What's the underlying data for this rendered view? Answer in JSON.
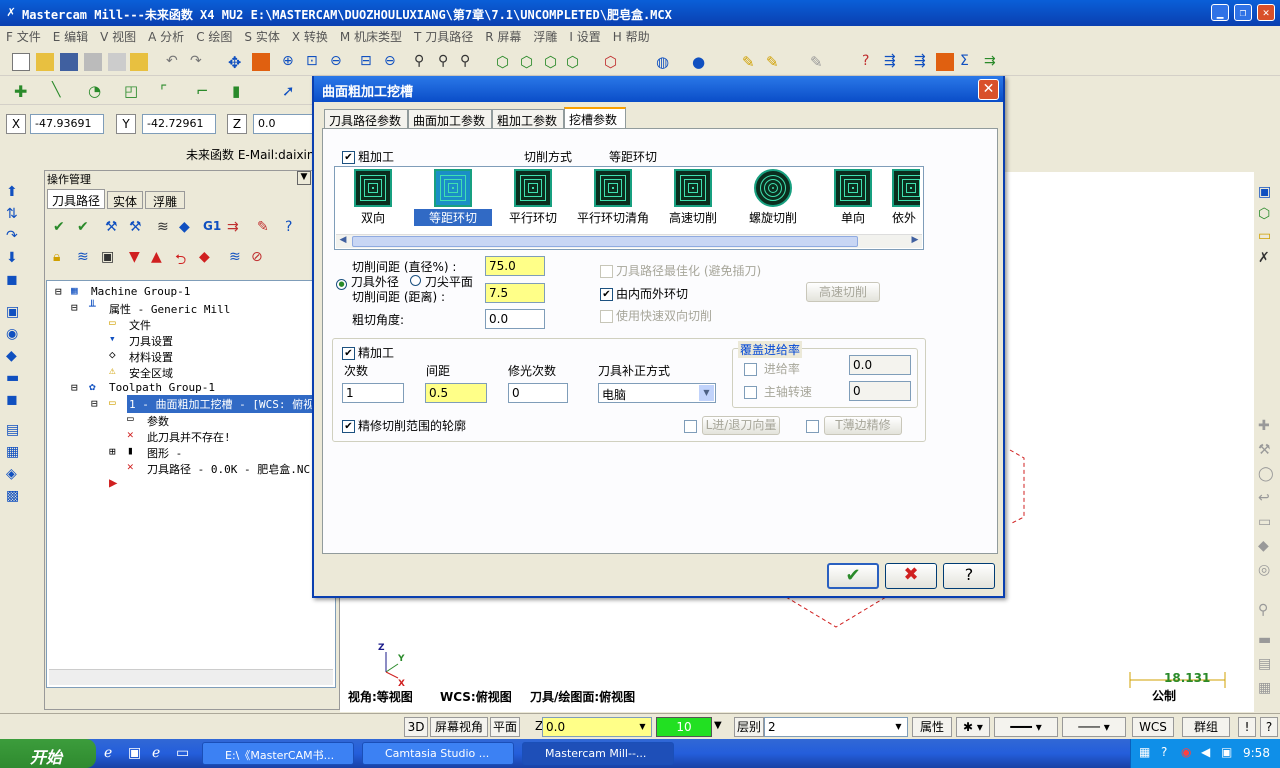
{
  "window": {
    "title": "Mastercam Mill---未来函数 X4 MU2  E:\\MASTERCAM\\DUOZHOULUXIANG\\第7章\\7.1\\UNCOMPLETED\\肥皂盒.MCX"
  },
  "menu": [
    "F 文件",
    "E 编辑",
    "V 视图",
    "A 分析",
    "C 绘图",
    "S 实体",
    "X 转换",
    "M 机床类型",
    "T 刀具路径",
    "R 屏幕",
    "浮雕",
    "I 设置",
    "H 帮助"
  ],
  "coords": {
    "x_label": "X",
    "x_value": "-47.93691",
    "y_label": "Y",
    "y_value": "-42.72961",
    "z_label": "Z",
    "z_value": "0.0"
  },
  "email_text": "未来函数 E-Mail:daixingbe",
  "opmgr": {
    "title": "操作管理",
    "tabs": [
      "刀具路径",
      "实体",
      "浮雕"
    ]
  },
  "tree": [
    "Machine Group-1",
    "属性 - Generic Mill",
    "文件",
    "刀具设置",
    "材料设置",
    "安全区域",
    "Toolpath Group-1",
    "1 - 曲面粗加工挖槽 - [WCS: 俯视",
    "参数",
    "此刀具并不存在!",
    "图形 -",
    "刀具路径 - 0.0K - 肥皂盒.NC"
  ],
  "dialog": {
    "title": "曲面粗加工挖槽",
    "close": "✕",
    "tabs": [
      "刀具路径参数",
      "曲面加工参数",
      "粗加工参数",
      "挖槽参数"
    ],
    "rough_label": "粗加工",
    "cut_method_label": "切削方式",
    "cut_method_value": "等距环切",
    "patterns": [
      "双向",
      "等距环切",
      "平行环切",
      "平行环切清角",
      "高速切削",
      "螺旋切削",
      "单向",
      "依外"
    ],
    "stepover_pct_label": "切削间距 (直径%) :",
    "stepover_pct": "75.0",
    "radio_outer": "刀具外径",
    "radio_tip": "刀尖平面",
    "stepover_dist_label": "切削间距 (距离) :",
    "stepover_dist": "7.5",
    "rough_angle_label": "粗切角度:",
    "rough_angle": "0.0",
    "optimize_label": "刀具路径最佳化 (避免插刀)",
    "inside_out_label": "由内而外环切",
    "fast_zigzag_label": "使用快速双向切削",
    "hs_button": "高速切削",
    "finish_label": "精加工",
    "passes_label": "次数",
    "passes": "1",
    "spacing_label": "间距",
    "spacing": "0.5",
    "spring_label": "修光次数",
    "spring": "0",
    "comp_label": "刀具补正方式",
    "comp_value": "电脑",
    "override_title": "覆盖进给率",
    "feed_label": "进给率",
    "feed_value": "0.0",
    "spindle_label": "主轴转速",
    "spindle_value": "0",
    "finish_contour_label": "精修切削范围的轮廓",
    "leadio_button": "L进/退刀向量",
    "thinwall_button": "T薄边精修"
  },
  "viewinfo": {
    "view": "视角:等视图",
    "wcs": "WCS:俯视图",
    "plane": "刀具/绘图面:俯视图",
    "scale": "18.131",
    "unit": "公制"
  },
  "statusbar": {
    "b3d": "3D",
    "screen_view": "屏幕视角",
    "plane": "平面",
    "z_label": "Z",
    "z_value": "0.0",
    "color": "10",
    "level_label": "层别",
    "level": "2",
    "attr": "属性",
    "wcs": "WCS",
    "group": "群组",
    "bang": "!"
  },
  "taskbar": {
    "start": "开始",
    "tasks": [
      "E:\\《MasterCAM书...",
      "Camtasia Studio ...",
      "Mastercam Mill--..."
    ],
    "time": "9:58"
  },
  "colors": {
    "title_blue": "#0a4dc8",
    "highlight": "#316ac5",
    "yellow_input": "#ffff88"
  }
}
